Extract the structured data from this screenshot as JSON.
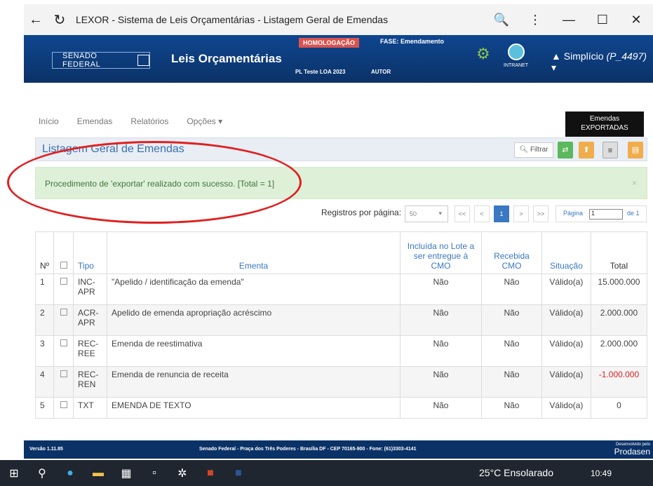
{
  "window": {
    "title": "LEXOR - Sistema de Leis Orçamentárias - Listagem Geral de Emendas",
    "controls": {
      "zoom": "🔍",
      "more": "⋮",
      "minimize": "—",
      "maximize": "☐",
      "close": "✕"
    }
  },
  "header": {
    "senado": "SENADO FEDERAL",
    "app_name": "Leis Orçamentárias",
    "env_badge": "HOMOLOGAÇÃO",
    "fase": "FASE: Emendamento",
    "pl": "PL Teste LOA 2023",
    "autor": "AUTOR",
    "intranet": "INTRANET",
    "user_name": "Simplício",
    "user_id": "(P_4497)"
  },
  "nav": {
    "items": [
      "Início",
      "Emendas",
      "Relatórios",
      "Opções"
    ]
  },
  "tooltip": {
    "line1": "Emendas",
    "line2": "EXPORTADAS"
  },
  "panel": {
    "title": "Listagem Geral de Emendas",
    "filter_label": "Filtrar"
  },
  "alert": {
    "message": "Procedimento de 'exportar' realizado com sucesso. [Total = 1]",
    "close": "×"
  },
  "pagination": {
    "label": "Registros por página:",
    "per_page": "50",
    "first": "<<",
    "prev": "<",
    "current": "1",
    "next": ">",
    "last": ">>",
    "page_label": "Página",
    "page_value": "1",
    "of": "de 1"
  },
  "table": {
    "headers": {
      "num": "Nº",
      "tipo": "Tipo",
      "ementa": "Ementa",
      "lote": "Incluída no Lote a ser entregue à CMO",
      "recebida": "Recebida CMO",
      "situacao": "Situação",
      "total": "Total"
    },
    "rows": [
      {
        "num": "1",
        "tipo": "INC-APR",
        "ementa": "\"Apelido / identificação da emenda\"",
        "lote": "Não",
        "recebida": "Não",
        "situacao": "Válido(a)",
        "total": "15.000.000"
      },
      {
        "num": "2",
        "tipo": "ACR-APR",
        "ementa": "Apelido de emenda apropriação acréscimo",
        "lote": "Não",
        "recebida": "Não",
        "situacao": "Válido(a)",
        "total": "2.000.000"
      },
      {
        "num": "3",
        "tipo": "REC-REE",
        "ementa": "Emenda de reestimativa",
        "lote": "Não",
        "recebida": "Não",
        "situacao": "Válido(a)",
        "total": "2.000.000"
      },
      {
        "num": "4",
        "tipo": "REC-REN",
        "ementa": "Emenda de renuncia de receita",
        "lote": "Não",
        "recebida": "Não",
        "situacao": "Válido(a)",
        "total": "-1.000.000"
      },
      {
        "num": "5",
        "tipo": "TXT",
        "ementa": "EMENDA DE TEXTO",
        "lote": "Não",
        "recebida": "Não",
        "situacao": "Válido(a)",
        "total": "0"
      }
    ]
  },
  "footer": {
    "version": "Versão 1.11.85",
    "address": "Senado Federal - Praça dos Três Poderes - Brasília DF - CEP 70165-900 - Fone: (61)3303-4141",
    "dev_small": "Desenvolvido pelo",
    "dev": "Prodasen"
  },
  "taskbar": {
    "weather": "25°C  Ensolarado",
    "time": "10:49"
  },
  "colors": {
    "header_bg": "#0d3b7a",
    "alert_bg": "#dff0d8",
    "accent": "#3a78c2",
    "annotation": "#e02020"
  }
}
